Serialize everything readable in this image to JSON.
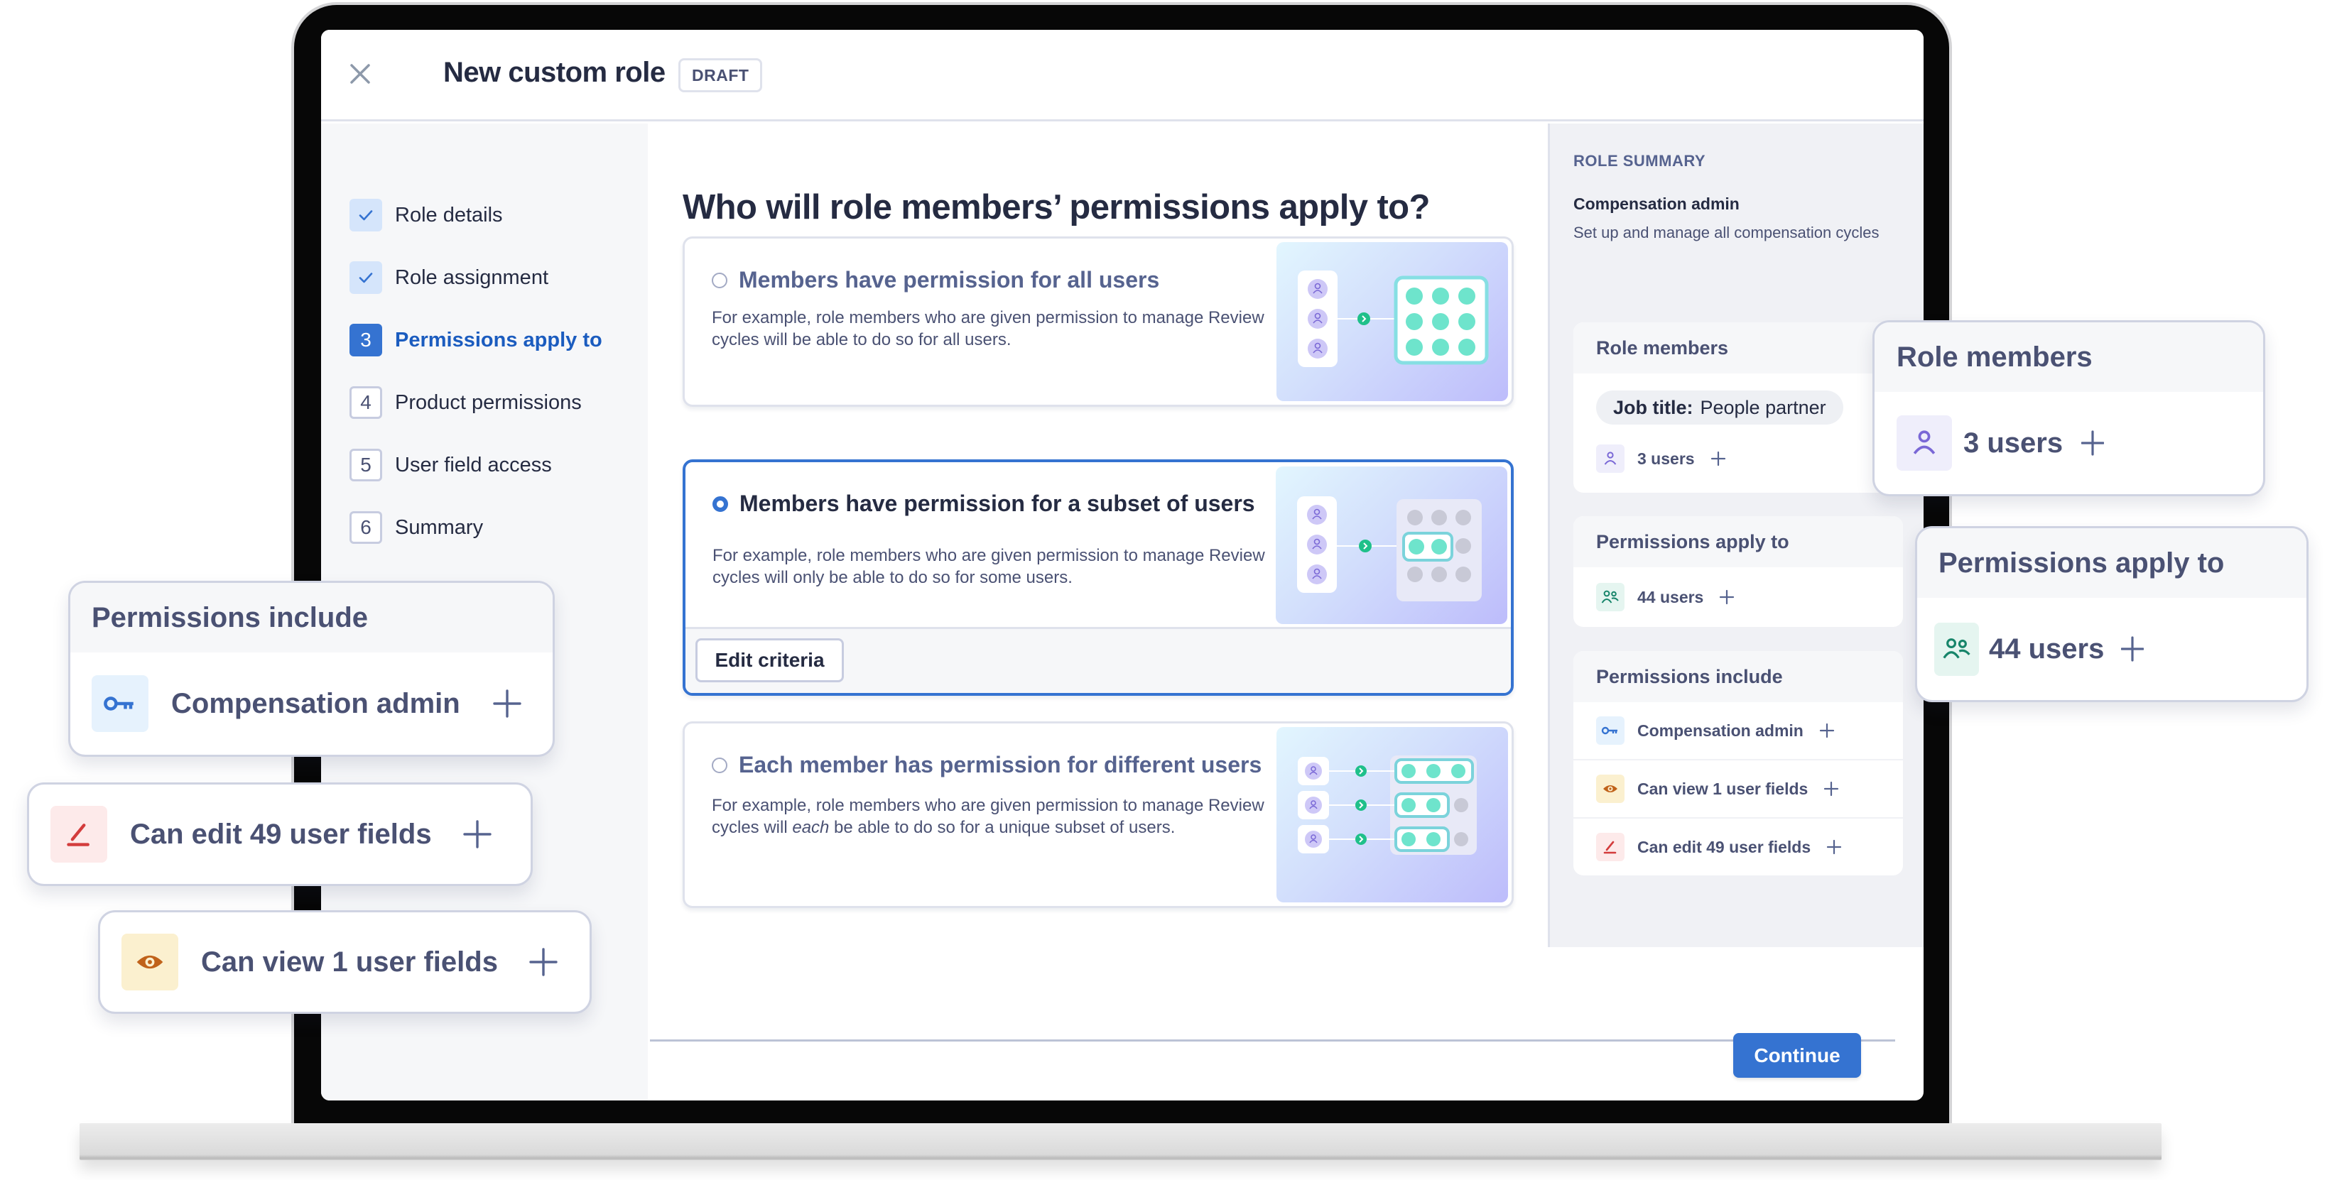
{
  "window": {
    "title": "New custom role",
    "status_badge": "DRAFT",
    "close_icon": "close-icon"
  },
  "steps": [
    {
      "number": "1",
      "label": "Role details",
      "state": "completed",
      "icon": "check-icon"
    },
    {
      "number": "2",
      "label": "Role assignment",
      "state": "completed",
      "icon": "check-icon"
    },
    {
      "number": "3",
      "label": "Permissions apply to",
      "state": "active"
    },
    {
      "number": "4",
      "label": "Product permissions",
      "state": "pending"
    },
    {
      "number": "5",
      "label": "User field access",
      "state": "pending"
    },
    {
      "number": "6",
      "label": "Summary",
      "state": "pending"
    }
  ],
  "main": {
    "heading": "Who will role members’ permissions apply to?",
    "options": [
      {
        "title": "Members have permission for all users",
        "description": "For example, role members who are given permission to manage Review cycles will be able to do so for all users.",
        "selected": false
      },
      {
        "title": "Members have permission for a subset of users",
        "description": "For example, role members who are given permission to manage Review cycles will only be able to do so for some users.",
        "selected": true,
        "action_label": "Edit criteria"
      },
      {
        "title": "Each member has permission for different users",
        "description_before": "For example, role members who are given permission to manage Review cycles will ",
        "description_emphasis": "each",
        "description_after": " be able to do so for a unique subset of users.",
        "selected": false
      }
    ],
    "continue_label": "Continue"
  },
  "summary": {
    "kicker": "ROLE SUMMARY",
    "role_name": "Compensation admin",
    "role_description": "Set up and manage all compensation cycles",
    "role_members": {
      "title": "Role members",
      "filter_key": "Job title:",
      "filter_value": "People partner",
      "count_label": "3 users",
      "icon": "person-icon"
    },
    "apply_to": {
      "title": "Permissions apply to",
      "count_label": "44 users",
      "icon": "people-icon"
    },
    "permissions_include": {
      "title": "Permissions include",
      "items": [
        {
          "label": "Compensation admin",
          "icon": "key-icon"
        },
        {
          "label": "Can view 1 user fields",
          "icon": "eye-icon"
        },
        {
          "label": "Can edit 49 user fields",
          "icon": "pencil-icon"
        }
      ]
    }
  },
  "floating": {
    "role_members": {
      "title": "Role members",
      "label": "3 users"
    },
    "apply_to": {
      "title": "Permissions apply to",
      "label": "44 users"
    },
    "permissions_include": {
      "title": "Permissions include",
      "label": "Compensation admin"
    },
    "edit_fields": {
      "label": "Can edit 49 user fields"
    },
    "view_fields": {
      "label": "Can view 1 user fields"
    }
  },
  "colors": {
    "accent": "#3573d1",
    "text_primary": "#252b42",
    "text_secondary": "#4a5173",
    "person_icon": "#7a68d6",
    "people_icon": "#17856a",
    "key_icon": "#3573d1",
    "eye_icon": "#c0621a",
    "pencil_icon": "#d33c3c"
  }
}
